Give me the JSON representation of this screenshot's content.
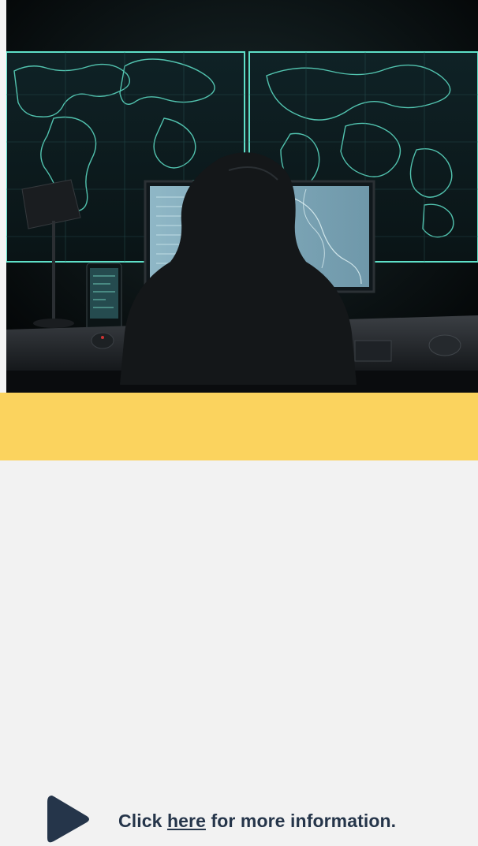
{
  "hero": {
    "image": "hooded person at desk facing monitors and large world map screens",
    "accent_color": "#5ee0c8"
  },
  "banner": {
    "background": "#fbd35e",
    "icon": "cursor-arrow-icon",
    "text_before": "Click",
    "link_text": "here",
    "text_after": "for more information."
  }
}
